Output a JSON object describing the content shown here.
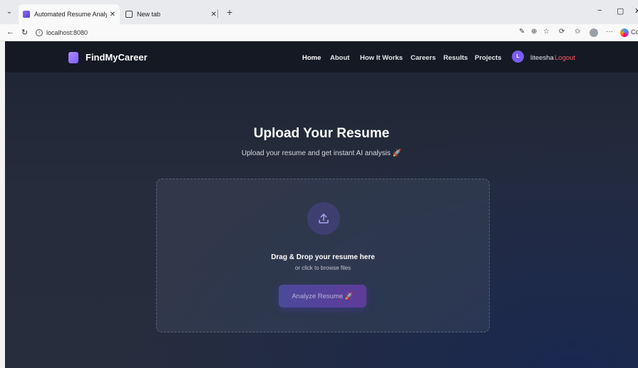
{
  "browser": {
    "tabs": [
      {
        "title": "Automated Resume Analysis & Sk",
        "active": true
      },
      {
        "title": "New tab",
        "active": false
      }
    ],
    "url": "localhost:8080",
    "window_controls": {
      "minimize": "−",
      "restore": "▢",
      "close": "✕"
    },
    "copilot_label": "Co"
  },
  "site": {
    "logo_text": "FindMyCareer",
    "nav": [
      {
        "label": "Home",
        "active": true
      },
      {
        "label": "About"
      },
      {
        "label": "How It Works"
      },
      {
        "label": "Careers"
      },
      {
        "label": "Results"
      },
      {
        "label": "Projects"
      }
    ],
    "user": {
      "initial": "L",
      "name": "liteesha",
      "logout": "Logout"
    }
  },
  "hero": {
    "title": "Upload Your Resume",
    "subtitle": "Upload your resume and get instant AI analysis",
    "subtitle_emoji": "🚀"
  },
  "dropzone": {
    "title": "Drag & Drop your resume here",
    "subtitle": "or click to browse files",
    "button_label": "Analyze Resume",
    "button_emoji": "🚀",
    "icon": "upload-icon"
  },
  "colors": {
    "accent": "#7b5cf0",
    "logout": "#ff5a66",
    "page_bg": "#252c3b"
  }
}
